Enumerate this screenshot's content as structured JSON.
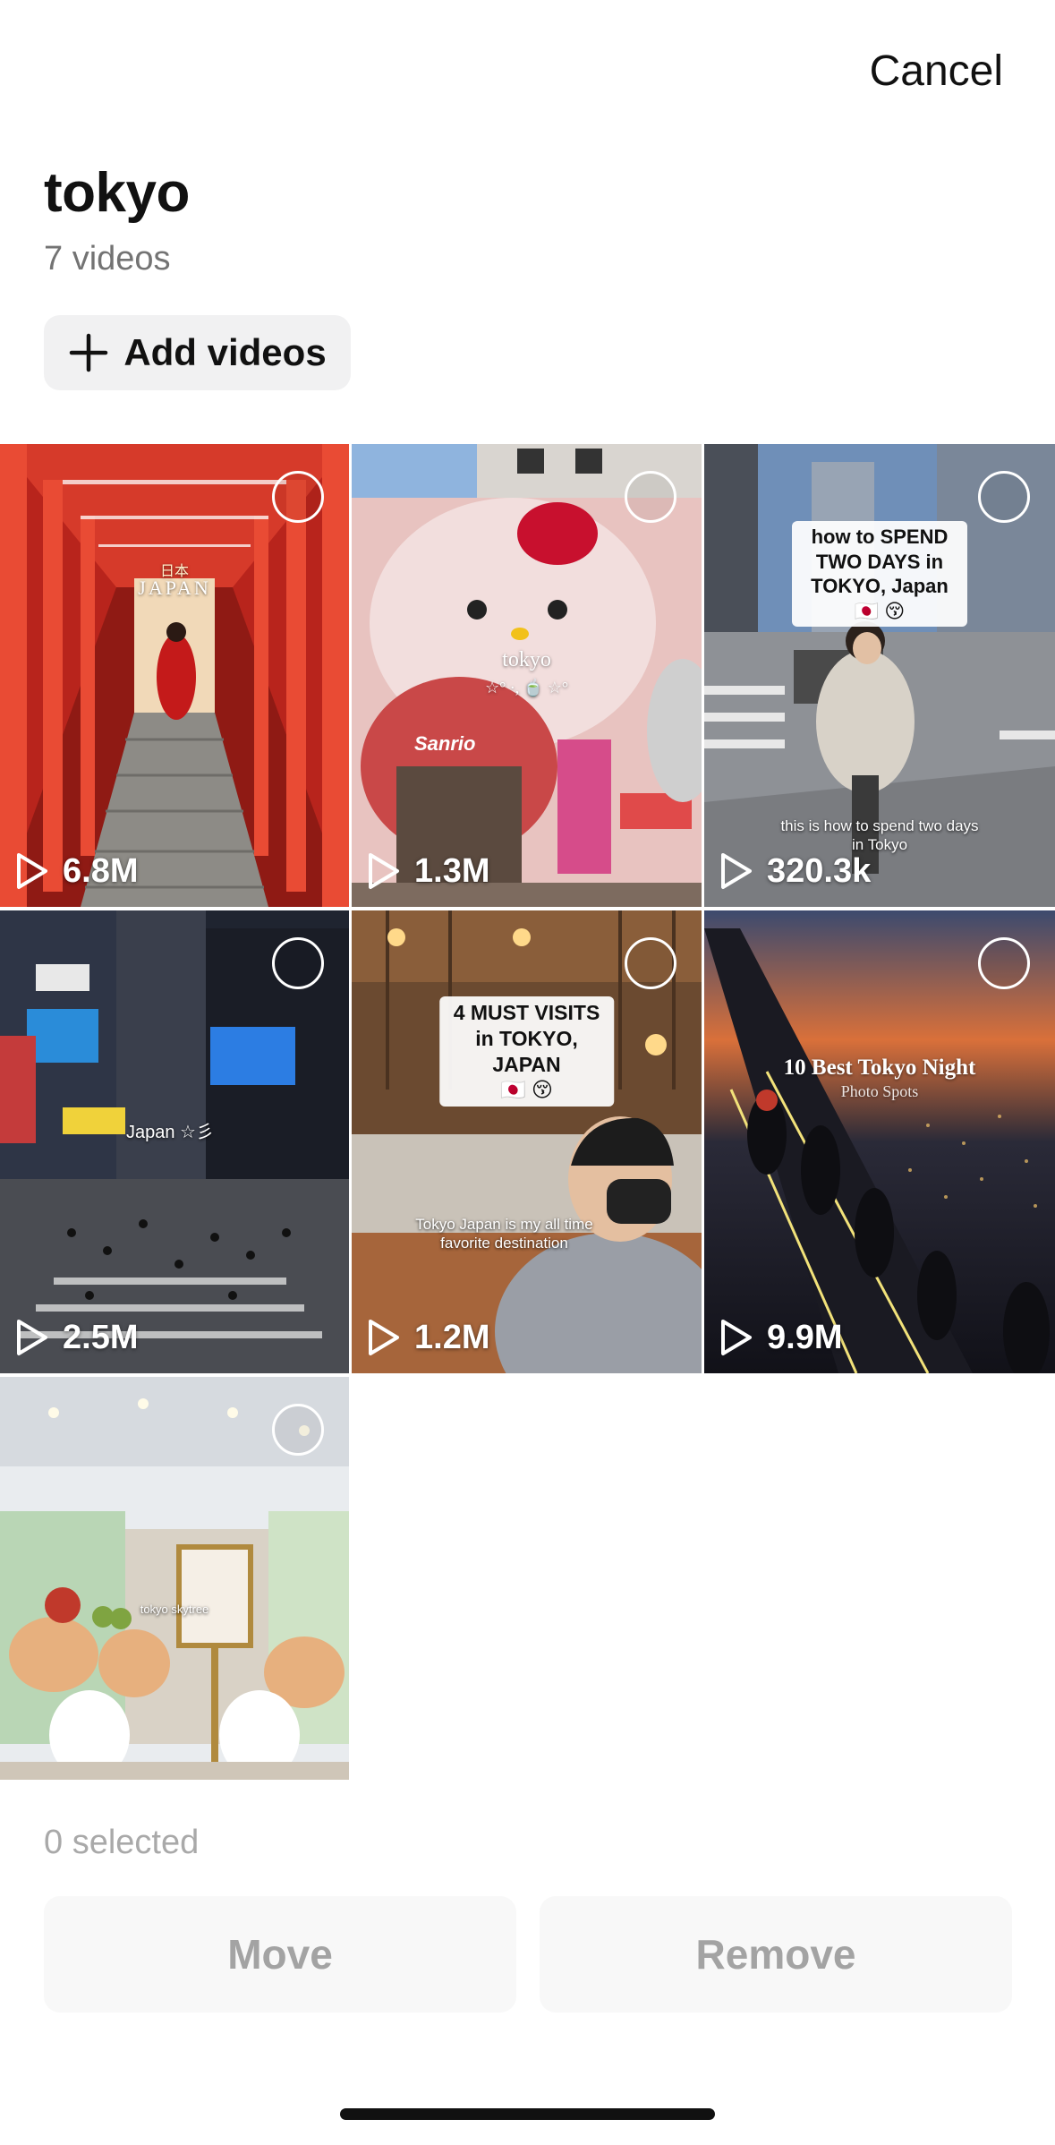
{
  "header": {
    "cancel_label": "Cancel"
  },
  "playlist": {
    "title": "tokyo",
    "video_count": "7 videos",
    "add_label": "Add videos"
  },
  "videos": [
    {
      "views": "6.8M",
      "sign_small": "日本",
      "sign_big": "JAPAN"
    },
    {
      "views": "1.3M",
      "overlay_title": "tokyo",
      "overlay_sub": "☆° ·, 🍵 ☆°",
      "brand": "Sanrio"
    },
    {
      "views": "320.3k",
      "overlay_text": "how to SPEND TWO DAYS in\nTOKYO, Japan\n🇯🇵 😚",
      "caption": "this is how to spend two days\nin Tokyo"
    },
    {
      "views": "2.5M",
      "caption": "Japan ☆彡"
    },
    {
      "views": "1.2M",
      "overlay_text": "4 MUST VISITS\nin TOKYO, JAPAN\n🇯🇵 😚",
      "caption": "Tokyo Japan is my all time\nfavorite destination"
    },
    {
      "views": "9.9M",
      "title": "10 Best Tokyo Night",
      "subtitle": "Photo Spots"
    },
    {
      "views": "",
      "caption": "tokyo skytree"
    }
  ],
  "footer": {
    "selected_label": "0 selected",
    "move_label": "Move",
    "remove_label": "Remove"
  },
  "colors": {
    "button_bg": "#f1f1f2",
    "disabled_text": "#a3a3a3",
    "secondary_text": "#737373"
  }
}
